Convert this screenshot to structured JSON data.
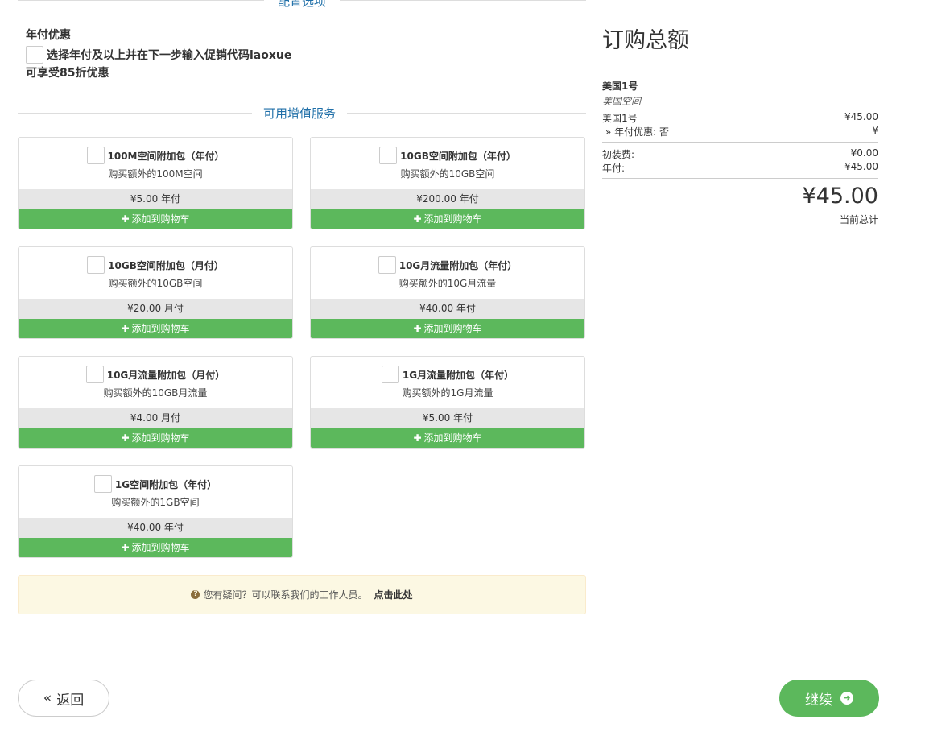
{
  "config_section": {
    "title": "配置选项"
  },
  "annual_promo": {
    "heading": "年付优惠",
    "line1": "选择年付及以上并在下一步输入促销代码laoxue",
    "line2": "可享受85折优惠"
  },
  "addons_section": {
    "title": "可用增值服务"
  },
  "addons": [
    {
      "name": "100M空间附加包（年付）",
      "desc": "购买额外的100M空间",
      "price": "¥5.00 年付",
      "button": "添加到购物车"
    },
    {
      "name": "10GB空间附加包（年付）",
      "desc": "购买额外的10GB空间",
      "price": "¥200.00 年付",
      "button": "添加到购物车"
    },
    {
      "name": "10GB空间附加包（月付）",
      "desc": "购买额外的10GB空间",
      "price": "¥20.00 月付",
      "button": "添加到购物车"
    },
    {
      "name": "10G月流量附加包（年付）",
      "desc": "购买额外的10G月流量",
      "price": "¥40.00 年付",
      "button": "添加到购物车"
    },
    {
      "name": "10G月流量附加包（月付）",
      "desc": "购买额外的10GB月流量",
      "price": "¥4.00 月付",
      "button": "添加到购物车"
    },
    {
      "name": "1G月流量附加包（年付）",
      "desc": "购买额外的1G月流量",
      "price": "¥5.00 年付",
      "button": "添加到购物车"
    },
    {
      "name": "1G空间附加包（年付）",
      "desc": "购买额外的1GB空间",
      "price": "¥40.00 年付",
      "button": "添加到购物车"
    }
  ],
  "help": {
    "text": "您有疑问？可以联系我们的工作人员。",
    "link": "点击此处"
  },
  "summary": {
    "title": "订购总额",
    "product_name": "美国1号",
    "product_group": "美国空间",
    "line_item_label": "美国1号",
    "line_item_value": "¥45.00",
    "option_label": "» 年付优惠: 否",
    "option_value": "¥",
    "setup_label": "初装费:",
    "setup_value": "¥0.00",
    "billing_label": "年付:",
    "billing_value": "¥45.00",
    "total": "¥45.00",
    "total_label": "当前总计"
  },
  "nav": {
    "back_label": "返回",
    "continue_label": "继续"
  },
  "colors": {
    "accent_green": "#5cb85c",
    "section_blue": "#1f6fa8",
    "help_bg": "#fcf8e3"
  }
}
